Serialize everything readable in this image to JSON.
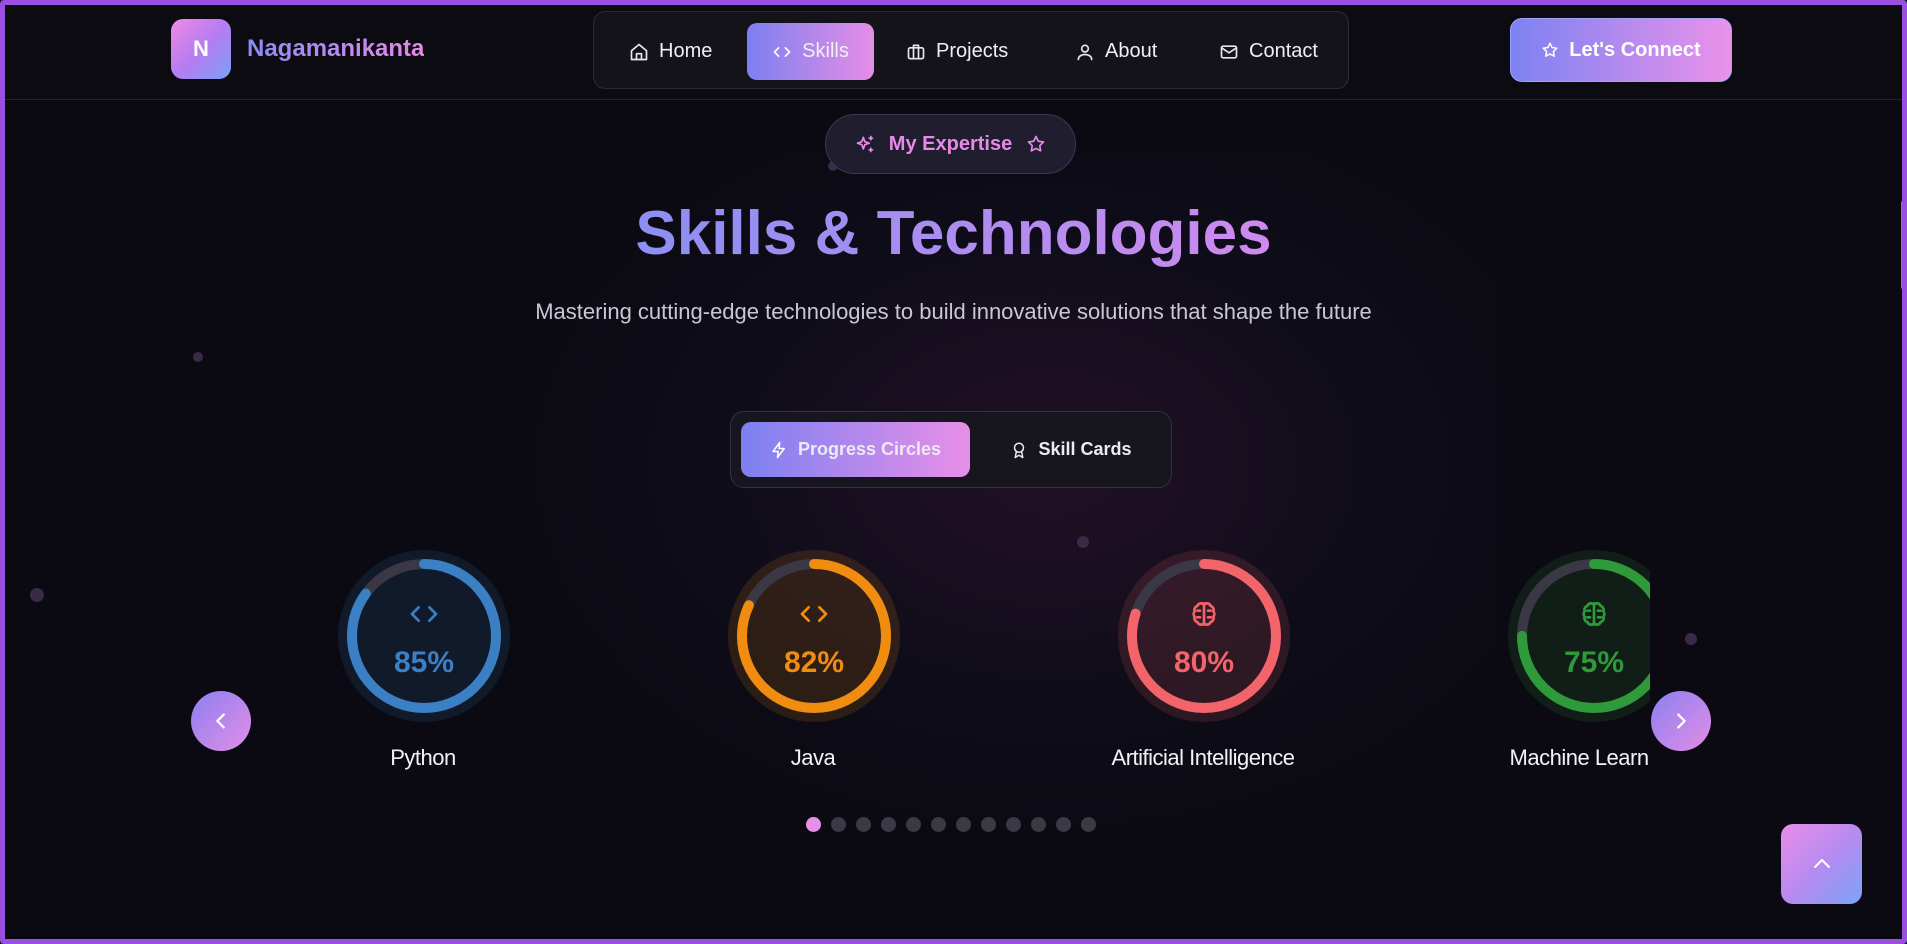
{
  "brand": {
    "logo_letter": "N",
    "name": "Nagamanikanta"
  },
  "nav": {
    "items": [
      {
        "label": "Home",
        "icon": "home-icon"
      },
      {
        "label": "Skills",
        "icon": "code-icon",
        "active": true
      },
      {
        "label": "Projects",
        "icon": "briefcase-icon"
      },
      {
        "label": "About",
        "icon": "user-icon"
      },
      {
        "label": "Contact",
        "icon": "mail-icon"
      }
    ],
    "cta_label": "Let's Connect"
  },
  "hero": {
    "badge": "My Expertise",
    "title": "Skills & Technologies",
    "subtitle": "Mastering cutting-edge technologies to build innovative solutions that shape the future"
  },
  "view_toggle": {
    "options": [
      "Progress Circles",
      "Skill Cards"
    ],
    "selected": "Progress Circles"
  },
  "skills": [
    {
      "name": "Python",
      "percent": "85%",
      "value": 85,
      "icon": "code-icon",
      "color": "#3b7fc4"
    },
    {
      "name": "Java",
      "percent": "82%",
      "value": 82,
      "icon": "code-icon",
      "color": "#f08c10"
    },
    {
      "name": "Artificial Intelligence",
      "percent": "80%",
      "value": 80,
      "icon": "brain-icon",
      "color": "#f2646a"
    },
    {
      "name": "Machine Learning",
      "percent": "75%",
      "value": 75,
      "icon": "brain-icon",
      "color": "#2f9a3a"
    }
  ],
  "carousel": {
    "page_count": 12,
    "current_page": 1
  },
  "colors": {
    "accent_start": "#7c80f1",
    "accent_end": "#e88fe8",
    "frame": "#9b4fe0"
  }
}
